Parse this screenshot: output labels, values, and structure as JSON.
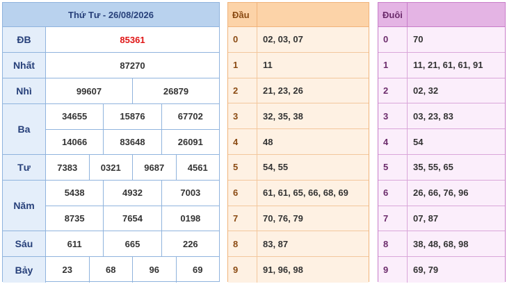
{
  "results": {
    "title": "Thứ Tư - 26/08/2026",
    "rows": [
      {
        "label": "ĐB",
        "lines": [
          [
            "85361"
          ]
        ]
      },
      {
        "label": "Nhất",
        "lines": [
          [
            "87270"
          ]
        ]
      },
      {
        "label": "Nhì",
        "lines": [
          [
            "99607",
            "26879"
          ]
        ]
      },
      {
        "label": "Ba",
        "lines": [
          [
            "34655",
            "15876",
            "67702"
          ],
          [
            "14066",
            "83648",
            "26091"
          ]
        ]
      },
      {
        "label": "Tư",
        "lines": [
          [
            "7383",
            "0321",
            "9687",
            "4561"
          ]
        ]
      },
      {
        "label": "Năm",
        "lines": [
          [
            "5438",
            "4932",
            "7003"
          ],
          [
            "8735",
            "7654",
            "0198"
          ]
        ]
      },
      {
        "label": "Sáu",
        "lines": [
          [
            "611",
            "665",
            "226"
          ]
        ]
      },
      {
        "label": "Bảy",
        "lines": [
          [
            "23",
            "68",
            "96",
            "69"
          ]
        ]
      }
    ]
  },
  "dau": {
    "header": "Đầu",
    "rows": [
      {
        "key": "0",
        "value": "02, 03, 07"
      },
      {
        "key": "1",
        "value": "11"
      },
      {
        "key": "2",
        "value": "21, 23, 26"
      },
      {
        "key": "3",
        "value": "32, 35, 38"
      },
      {
        "key": "4",
        "value": "48"
      },
      {
        "key": "5",
        "value": "54, 55"
      },
      {
        "key": "6",
        "value": "61, 61, 65, 66, 68, 69"
      },
      {
        "key": "7",
        "value": "70, 76, 79"
      },
      {
        "key": "8",
        "value": "83, 87"
      },
      {
        "key": "9",
        "value": "91, 96, 98"
      }
    ]
  },
  "duoi": {
    "header": "Đuôi",
    "rows": [
      {
        "key": "0",
        "value": "70"
      },
      {
        "key": "1",
        "value": "11, 21, 61, 61, 91"
      },
      {
        "key": "2",
        "value": "02, 32"
      },
      {
        "key": "3",
        "value": "03, 23, 83"
      },
      {
        "key": "4",
        "value": "54"
      },
      {
        "key": "5",
        "value": "35, 55, 65"
      },
      {
        "key": "6",
        "value": "26, 66, 76, 96"
      },
      {
        "key": "7",
        "value": "07, 87"
      },
      {
        "key": "8",
        "value": "38, 48, 68, 98"
      },
      {
        "key": "9",
        "value": "69, 79"
      }
    ]
  },
  "colors": {
    "special_prize": "#e01515",
    "results_header": "#b9d2ee",
    "dau_header": "#fcd3a8",
    "duoi_header": "#e4b4e4"
  }
}
